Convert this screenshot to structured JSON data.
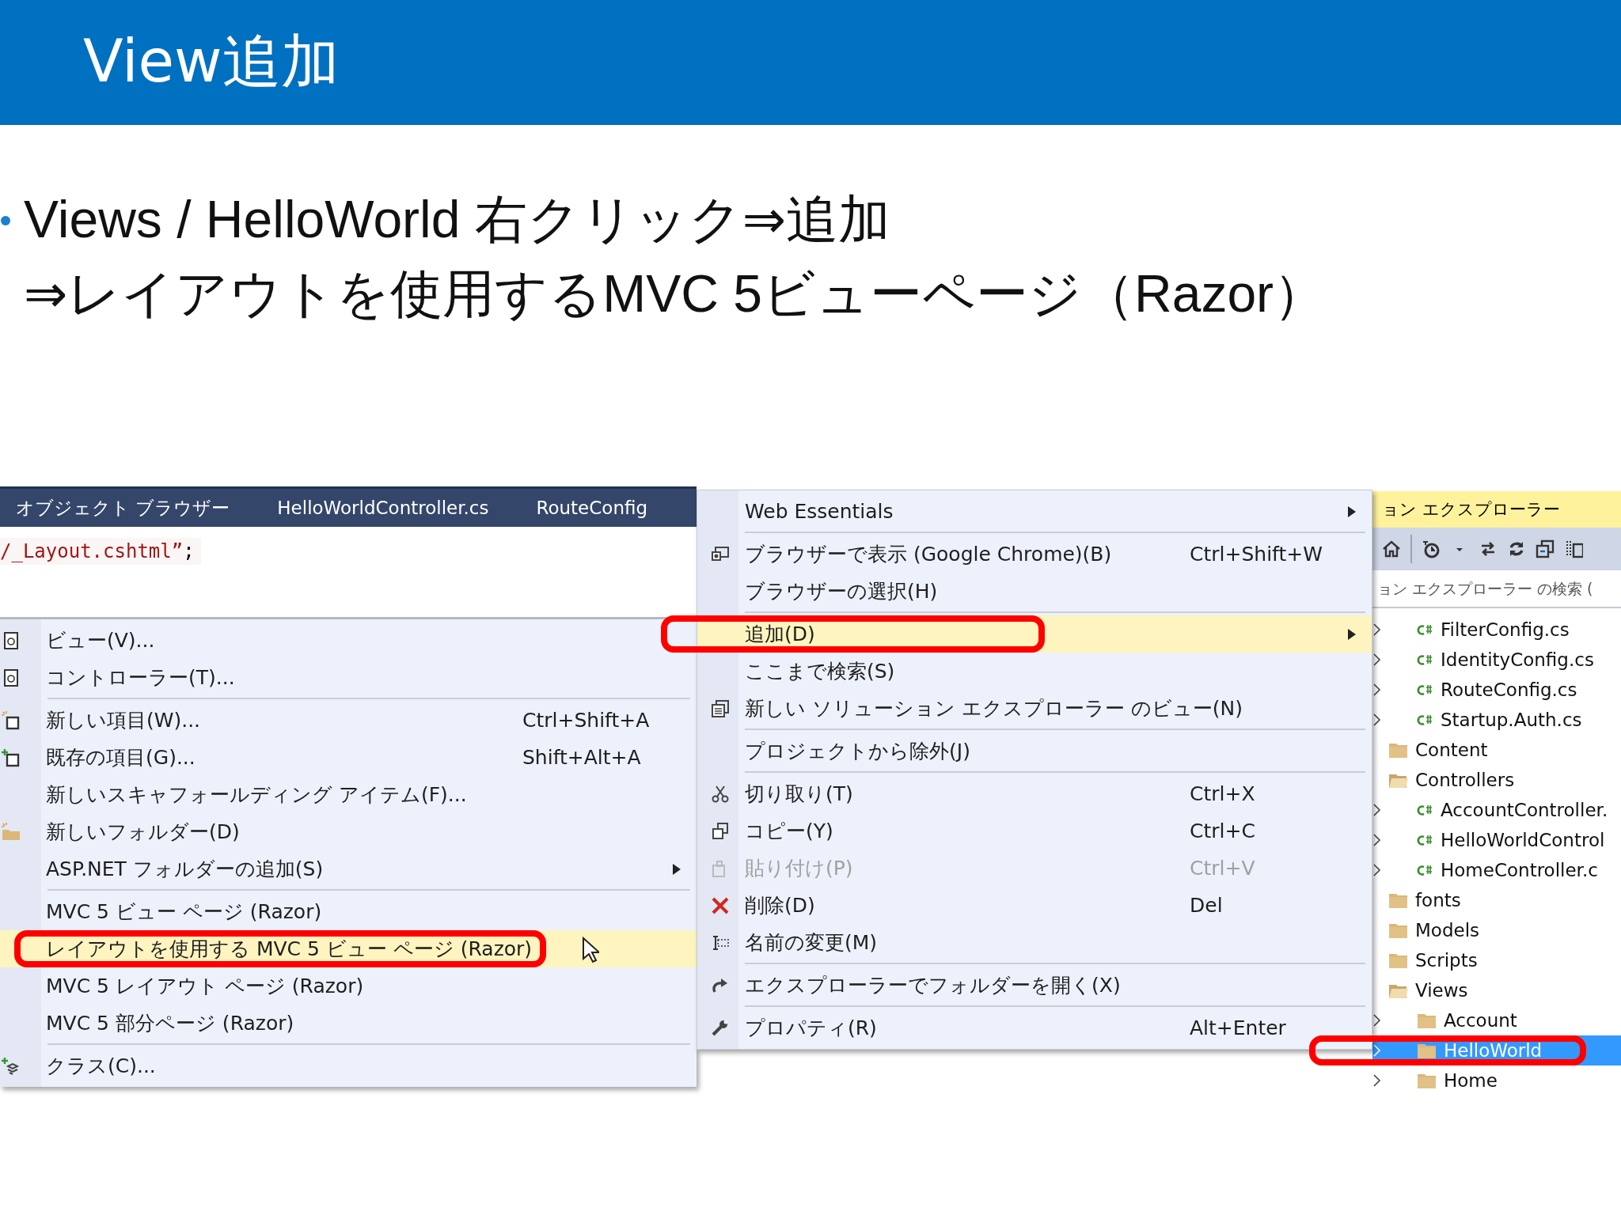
{
  "slide": {
    "title": "View追加",
    "bullets": [
      {
        "lines": [
          "Views / HelloWorld 右クリック⇒追加",
          "⇒レイアウトを使用するMVC 5ビューページ（Razor）"
        ]
      }
    ]
  },
  "screenshot": {
    "editor": {
      "tabs": [
        {
          "label": "オブジェクト ブラウザー"
        },
        {
          "label": "HelloWorldController.cs"
        },
        {
          "label": "RouteConfig"
        }
      ],
      "code_line": [
        {
          "kind": "string",
          "text": "/_Layout.cshtml”"
        },
        {
          "kind": "plain",
          "text": ";"
        }
      ]
    },
    "add_submenu": {
      "items": [
        {
          "kind": "item",
          "label": "ビュー(V)...",
          "selected": false,
          "submenu": false,
          "callout": false
        },
        {
          "kind": "item",
          "label": "コントローラー(T)...",
          "selected": false,
          "submenu": false,
          "callout": false
        },
        {
          "kind": "separator"
        },
        {
          "kind": "item",
          "label": "新しい項目(W)...",
          "shortcut": "Ctrl+Shift+A",
          "selected": false,
          "submenu": false,
          "callout": false
        },
        {
          "kind": "item",
          "label": "既存の項目(G)...",
          "shortcut": "Shift+Alt+A",
          "selected": false,
          "submenu": false,
          "callout": false
        },
        {
          "kind": "item",
          "label": "新しいスキャフォールディング アイテム(F)...",
          "selected": false,
          "submenu": false,
          "callout": false
        },
        {
          "kind": "item",
          "label": "新しいフォルダー(D)",
          "selected": false,
          "submenu": false,
          "callout": false
        },
        {
          "kind": "item",
          "label": "ASP.NET フォルダーの追加(S)",
          "selected": false,
          "submenu": true,
          "callout": false
        },
        {
          "kind": "separator"
        },
        {
          "kind": "item",
          "label": "MVC 5 ビュー ページ (Razor)",
          "selected": false,
          "submenu": false,
          "callout": false
        },
        {
          "kind": "item",
          "label": "レイアウトを使用する MVC 5 ビュー ページ (Razor)",
          "selected": true,
          "submenu": false,
          "callout": true
        },
        {
          "kind": "item",
          "label": "MVC 5 レイアウト ページ (Razor)",
          "selected": false,
          "submenu": false,
          "callout": false
        },
        {
          "kind": "item",
          "label": "MVC 5 部分ページ (Razor)",
          "selected": false,
          "submenu": false,
          "callout": false
        },
        {
          "kind": "separator"
        },
        {
          "kind": "item",
          "label": "クラス(C)...",
          "selected": false,
          "submenu": false,
          "callout": false
        }
      ]
    },
    "context_menu": {
      "items": [
        {
          "kind": "item",
          "label": "Web Essentials",
          "selected": false,
          "submenu": true,
          "disabled": false,
          "callout": false
        },
        {
          "kind": "separator"
        },
        {
          "kind": "item",
          "label": "ブラウザーで表示 (Google Chrome)(B)",
          "shortcut": "Ctrl+Shift+W",
          "selected": false,
          "submenu": false,
          "disabled": false,
          "callout": false
        },
        {
          "kind": "item",
          "label": "ブラウザーの選択(H)",
          "selected": false,
          "submenu": false,
          "disabled": false,
          "callout": false
        },
        {
          "kind": "separator"
        },
        {
          "kind": "item",
          "label": "追加(D)",
          "selected": true,
          "submenu": true,
          "disabled": false,
          "callout": true
        },
        {
          "kind": "item",
          "label": "ここまで検索(S)",
          "selected": false,
          "submenu": false,
          "disabled": false,
          "callout": false
        },
        {
          "kind": "item",
          "label": "新しい ソリューション エクスプローラー のビュー(N)",
          "selected": false,
          "submenu": false,
          "disabled": false,
          "callout": false
        },
        {
          "kind": "separator"
        },
        {
          "kind": "item",
          "label": "プロジェクトから除外(J)",
          "selected": false,
          "submenu": false,
          "disabled": false,
          "callout": false
        },
        {
          "kind": "separator"
        },
        {
          "kind": "item",
          "label": "切り取り(T)",
          "shortcut": "Ctrl+X",
          "selected": false,
          "submenu": false,
          "disabled": false,
          "callout": false
        },
        {
          "kind": "item",
          "label": "コピー(Y)",
          "shortcut": "Ctrl+C",
          "selected": false,
          "submenu": false,
          "disabled": false,
          "callout": false
        },
        {
          "kind": "item",
          "label": "貼り付け(P)",
          "shortcut": "Ctrl+V",
          "selected": false,
          "submenu": false,
          "disabled": true,
          "callout": false
        },
        {
          "kind": "item",
          "label": "削除(D)",
          "shortcut": "Del",
          "selected": false,
          "submenu": false,
          "disabled": false,
          "callout": false
        },
        {
          "kind": "item",
          "label": "名前の変更(M)",
          "selected": false,
          "submenu": false,
          "disabled": false,
          "callout": false
        },
        {
          "kind": "separator"
        },
        {
          "kind": "item",
          "label": "エクスプローラーでフォルダーを開く(X)",
          "selected": false,
          "submenu": false,
          "disabled": false,
          "callout": false
        },
        {
          "kind": "separator"
        },
        {
          "kind": "item",
          "label": "プロパティ(R)",
          "shortcut": "Alt+Enter",
          "selected": false,
          "submenu": false,
          "disabled": false,
          "callout": false
        }
      ]
    },
    "solution_explorer": {
      "title": "ョン エクスプローラー",
      "search": {
        "placeholder": "ョン エクスプローラー の検索 ("
      },
      "tree": [
        {
          "kind": "file",
          "label": "FilterConfig.cs",
          "arrow": true,
          "expanded": false,
          "selected": false,
          "callout": false
        },
        {
          "kind": "file",
          "label": "IdentityConfig.cs",
          "arrow": true,
          "expanded": false,
          "selected": false,
          "callout": false
        },
        {
          "kind": "file",
          "label": "RouteConfig.cs",
          "arrow": true,
          "expanded": false,
          "selected": false,
          "callout": false
        },
        {
          "kind": "file",
          "label": "Startup.Auth.cs",
          "arrow": true,
          "expanded": false,
          "selected": false,
          "callout": false
        },
        {
          "kind": "folder",
          "label": "Content",
          "arrow": false,
          "expanded": false,
          "selected": false,
          "callout": false
        },
        {
          "kind": "folder",
          "label": "Controllers",
          "arrow": false,
          "expanded": true,
          "selected": false,
          "callout": false,
          "children": [
            {
              "kind": "file",
              "label": "AccountController.",
              "arrow": true,
              "expanded": false,
              "selected": false,
              "callout": false
            },
            {
              "kind": "file",
              "label": "HelloWorldControl",
              "arrow": true,
              "expanded": false,
              "selected": false,
              "callout": false
            },
            {
              "kind": "file",
              "label": "HomeController.c",
              "arrow": true,
              "expanded": false,
              "selected": false,
              "callout": false
            }
          ]
        },
        {
          "kind": "folder",
          "label": "fonts",
          "arrow": false,
          "expanded": false,
          "selected": false,
          "callout": false
        },
        {
          "kind": "folder",
          "label": "Models",
          "arrow": false,
          "expanded": false,
          "selected": false,
          "callout": false
        },
        {
          "kind": "folder",
          "label": "Scripts",
          "arrow": false,
          "expanded": false,
          "selected": false,
          "callout": false
        },
        {
          "kind": "folder",
          "label": "Views",
          "arrow": false,
          "expanded": true,
          "selected": false,
          "callout": false,
          "children": [
            {
              "kind": "folder",
              "label": "Account",
              "arrow": true,
              "expanded": false,
              "selected": false,
              "callout": false
            },
            {
              "kind": "folder",
              "label": "HelloWorld",
              "arrow": true,
              "expanded": false,
              "selected": true,
              "callout": true
            },
            {
              "kind": "folder",
              "label": "Home",
              "arrow": true,
              "expanded": false,
              "selected": false,
              "callout": false
            }
          ]
        }
      ]
    }
  }
}
